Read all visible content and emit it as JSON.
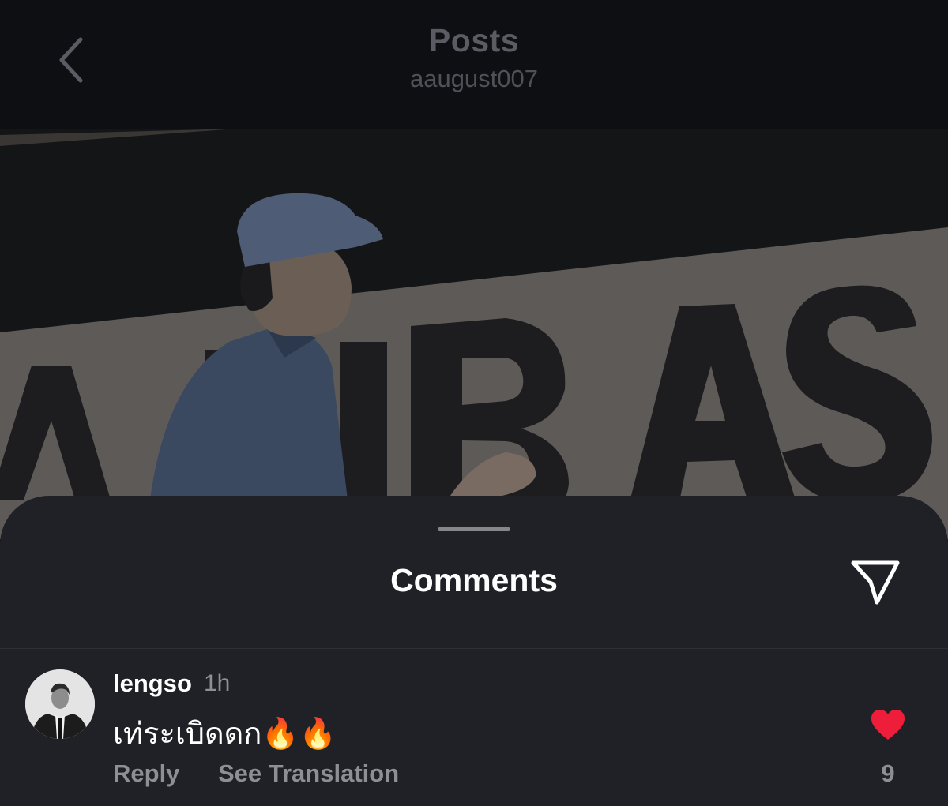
{
  "header": {
    "title": "Posts",
    "subtitle": "aaugust007",
    "back_icon": "chevron-left-icon"
  },
  "post": {
    "background_text": "ADIBAS"
  },
  "comments_sheet": {
    "title": "Comments",
    "share_icon": "paper-plane-icon",
    "comments": [
      {
        "username": "lengso",
        "time": "1h",
        "text": "เท่ระเบิดดก🔥🔥",
        "reply_label": "Reply",
        "translate_label": "See Translation",
        "like_count": "9",
        "liked": true
      }
    ]
  },
  "colors": {
    "background": "#0f1013",
    "sheet": "#202127",
    "secondary_text": "#8e8f95",
    "like": "#ee1e3b"
  }
}
